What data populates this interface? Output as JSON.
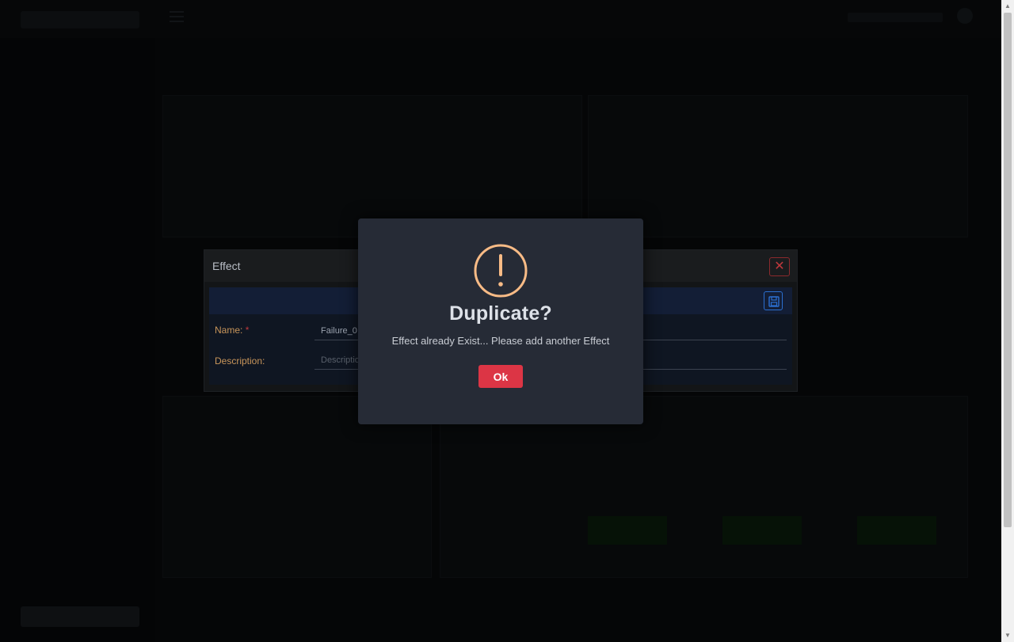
{
  "effect_modal": {
    "title": "Effect",
    "name_label": "Name:",
    "required_mark": "*",
    "name_value": "Failure_0",
    "description_label": "Description:",
    "description_placeholder": "Description"
  },
  "alert": {
    "title": "Duplicate?",
    "message": "Effect already Exist... Please add another Effect",
    "ok_label": "Ok",
    "icon": "exclamation-circle-icon"
  },
  "colors": {
    "alert_background": "#262b36",
    "ok_button": "#dc3545",
    "warning_icon": "#f8bb86",
    "label_text": "#c8955a",
    "close_button": "#c0393d",
    "save_button": "#2b6fcf"
  }
}
